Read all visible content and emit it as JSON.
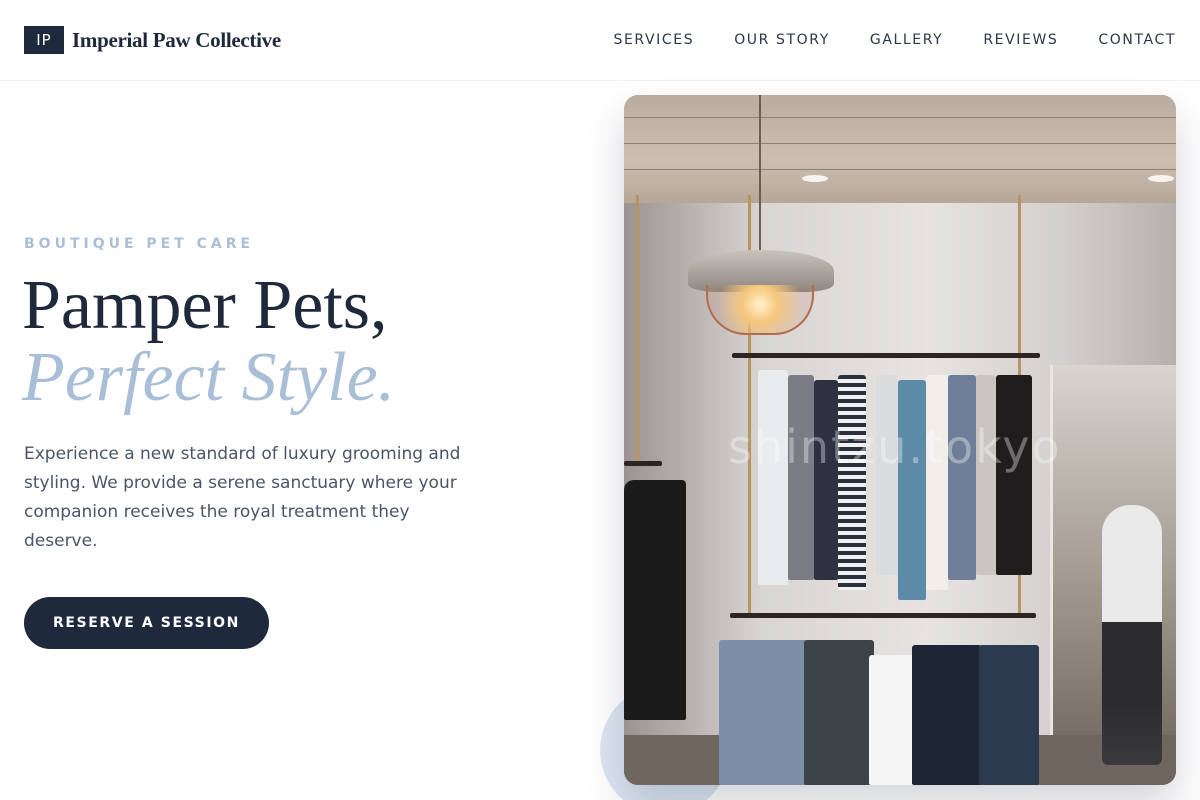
{
  "brand": {
    "logo_text": "IP",
    "name": "Imperial Paw Collective"
  },
  "nav": {
    "items": [
      {
        "label": "SERVICES"
      },
      {
        "label": "OUR STORY"
      },
      {
        "label": "GALLERY"
      },
      {
        "label": "REVIEWS"
      },
      {
        "label": "CONTACT"
      }
    ]
  },
  "hero": {
    "eyebrow": "BOUTIQUE PET CARE",
    "headline_line1": "Pamper Pets,",
    "headline_line2": "Perfect Style.",
    "lead": "Experience a new standard of luxury grooming and styling. We provide a serene sanctuary where your companion receives the royal treatment they deserve.",
    "cta_label": "RESERVE A SESSION",
    "image_watermark": "shintzu.tokyo"
  },
  "colors": {
    "primary": "#1e293b",
    "accent": "#a9bfd8",
    "body_text": "#4a5568",
    "deco_circle": "#dce6f1"
  }
}
